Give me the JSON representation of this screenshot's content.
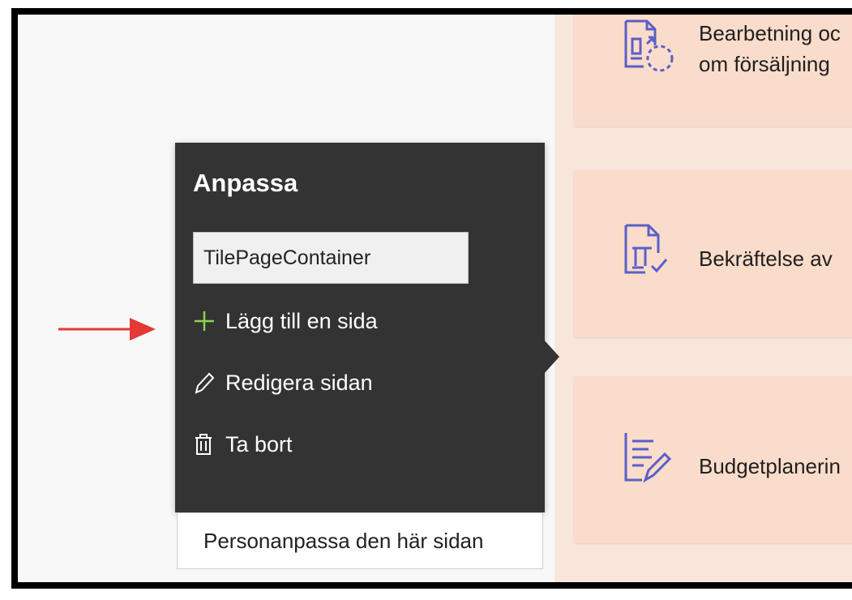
{
  "tiles": [
    {
      "title": "Bearbetning oc\nom försäljning",
      "icon": "document-sync-icon"
    },
    {
      "title": "Bekräftelse av",
      "icon": "document-check-icon"
    },
    {
      "title": "Budgetplanerin",
      "icon": "document-edit-icon"
    }
  ],
  "popup": {
    "title": "Anpassa",
    "container_name": "TilePageContainer",
    "menu": {
      "add_label": "Lägg till en sida",
      "edit_label": "Redigera sidan",
      "delete_label": "Ta bort"
    },
    "personalize_label": "Personanpassa den här sidan"
  },
  "colors": {
    "popup_bg": "#333333",
    "tile_bg": "#fadccb",
    "panel_bg": "#f9e6db",
    "icon_color": "#5b5fc7",
    "arrow_color": "#e53935"
  }
}
